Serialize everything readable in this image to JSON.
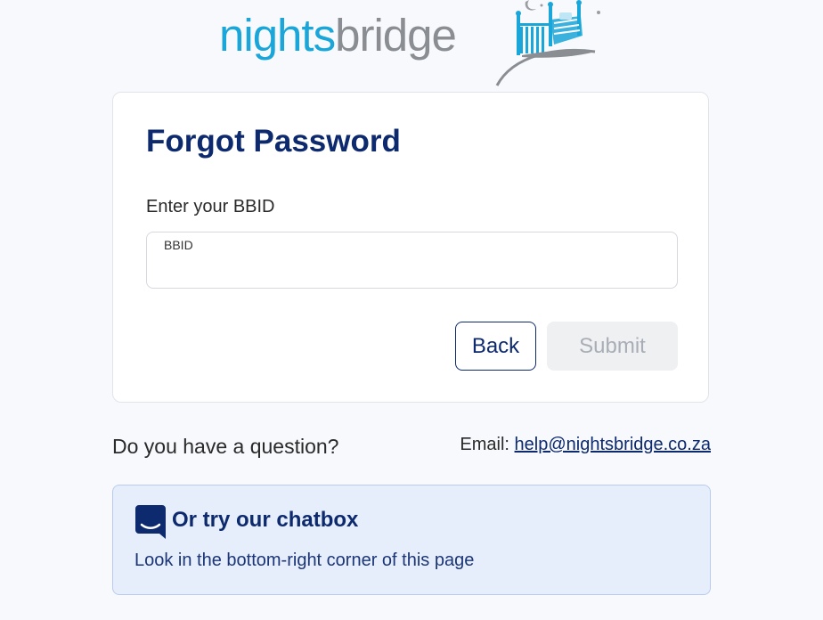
{
  "logo": {
    "part1": "nights",
    "part2": "bridge",
    "icon": "bed-moon-logo-icon",
    "colors": {
      "primary": "#1aa6d8",
      "secondary": "#8a8d91"
    }
  },
  "form": {
    "title": "Forgot Password",
    "field_label": "Enter your BBID",
    "input_label": "BBID",
    "input_value": "",
    "back_label": "Back",
    "submit_label": "Submit"
  },
  "help": {
    "question": "Do you have a question?",
    "email_prefix": "Email:",
    "email": "help@nightsbridge.co.za"
  },
  "chat": {
    "icon": "chat-icon",
    "title": "Or try our chatbox",
    "subtitle": "Look in the bottom-right corner of this page"
  },
  "colors": {
    "brand_navy": "#0d2a6e",
    "background": "#f7f9fd",
    "chat_bg": "#e6eefc"
  }
}
